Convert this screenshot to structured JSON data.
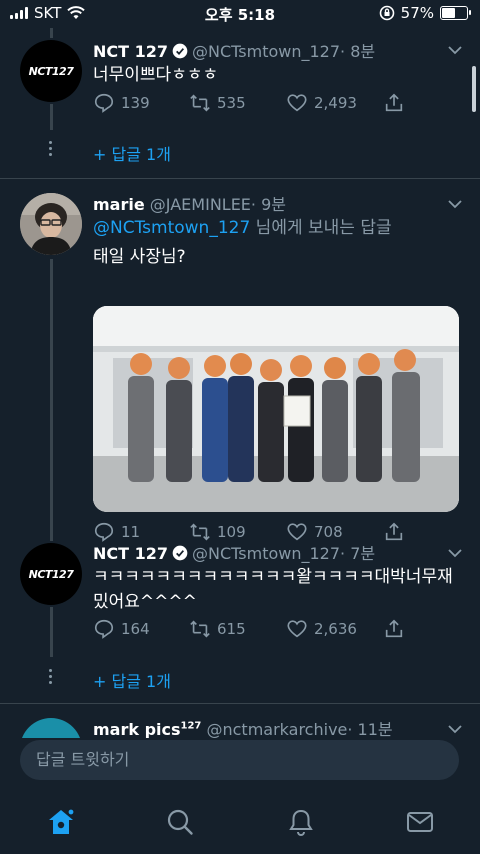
{
  "status_bar": {
    "carrier": "SKT",
    "time": "오후 5:18",
    "battery": "57%",
    "battery_level": 0.57
  },
  "tweets": [
    {
      "name": "NCT 127",
      "handle": "@NCTsmtown_127",
      "time": "· 8분",
      "verified": true,
      "avatar_text": "NCT127",
      "text": "너무이쁘다ㅎㅎㅎ",
      "replies": "139",
      "retweets": "535",
      "likes": "2,493",
      "more_replies": "+ 답글 1개"
    },
    {
      "name": "marie",
      "handle": "@JAEMINLEE",
      "time": "· 9분",
      "reply_to": "@NCTsmtown_127",
      "reply_suffix": " 님에게 보내는 답글",
      "text": "태일 사장님?",
      "replies": "11",
      "retweets": "109",
      "likes": "708"
    },
    {
      "name": "NCT 127",
      "handle": "@NCTsmtown_127",
      "time": "· 7분",
      "verified": true,
      "avatar_text": "NCT127",
      "text": "ㅋㅋㅋㅋㅋㅋㅋㅋㅋㅋㅋㅋㅋ왈ㅋㅋㅋㅋ대박너무재밌어요^^^^",
      "replies": "164",
      "retweets": "615",
      "likes": "2,636",
      "more_replies": "+ 답글 1개"
    },
    {
      "name": "mark pics",
      "name_sup": "127",
      "handle": "@nctmarkarchive",
      "time": "· 11분"
    }
  ],
  "reply_bar": {
    "placeholder": "답글 트윗하기"
  },
  "tabbar": {
    "items": [
      "home-icon",
      "search-icon",
      "notifications-icon",
      "messages-icon"
    ],
    "active": "home-icon"
  },
  "colors": {
    "background": "#15202b",
    "accent": "#1da1f2",
    "muted": "#8899a6",
    "divider": "#38444d"
  }
}
